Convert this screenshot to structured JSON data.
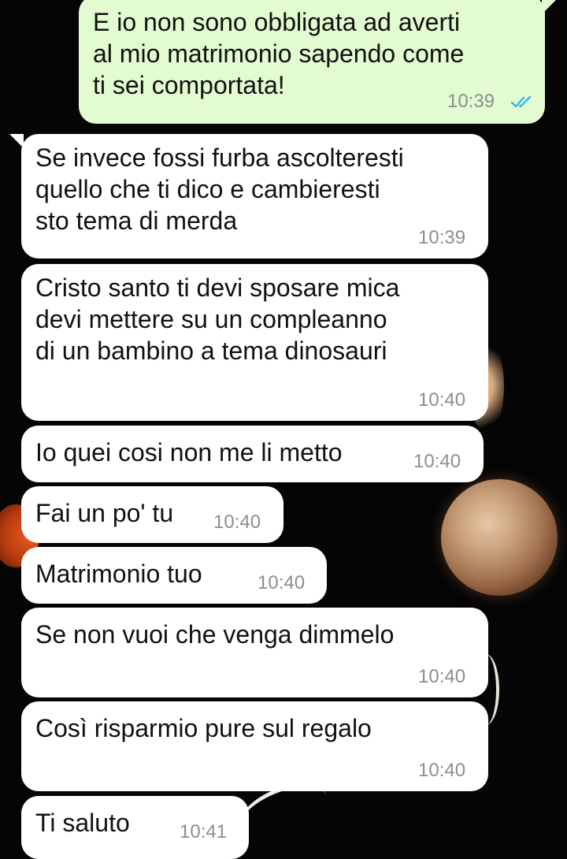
{
  "chat": {
    "messages": [
      {
        "direction": "out",
        "text": "E io non sono obbligata ad averti\nal mio matrimonio sapendo come\nti sei comportata!",
        "time": "10:39",
        "status": "read",
        "status_icon": "double-check-icon",
        "status_color": "#34b7f1"
      },
      {
        "direction": "in",
        "text": "Se invece fossi furba ascolteresti\nquello che ti dico e cambieresti\nsto tema di merda",
        "time": "10:39"
      },
      {
        "direction": "in",
        "text": "Cristo santo ti devi sposare mica\ndevi mettere su un compleanno\ndi un bambino a tema dinosauri",
        "time": "10:40"
      },
      {
        "direction": "in",
        "text": "Io quei cosi non me li metto",
        "time": "10:40"
      },
      {
        "direction": "in",
        "text": "Fai un po' tu",
        "time": "10:40"
      },
      {
        "direction": "in",
        "text": "Matrimonio tuo",
        "time": "10:40"
      },
      {
        "direction": "in",
        "text": "Se non vuoi che venga dimmelo",
        "time": "10:40"
      },
      {
        "direction": "in",
        "text": "Così risparmio pure sul regalo",
        "time": "10:40"
      },
      {
        "direction": "in",
        "text": "Ti saluto",
        "time": "10:41"
      }
    ]
  },
  "theme": {
    "incoming_bubble": "#ffffff",
    "outgoing_bubble": "#e2fbd0",
    "timestamp_color": "#8a8f93",
    "read_tick_color": "#34b7f1",
    "wallpaper": "dark night sky with moons"
  }
}
